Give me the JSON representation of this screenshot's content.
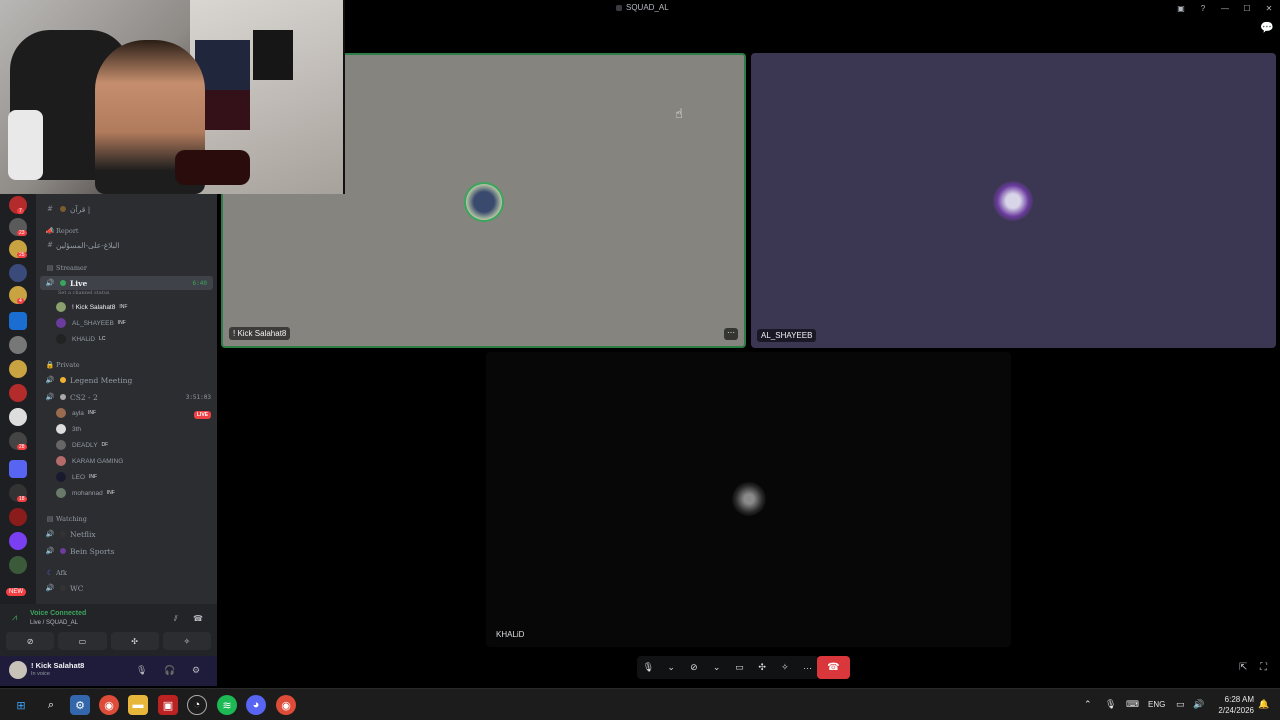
{
  "window": {
    "title": "SQUAD_AL"
  },
  "sidebar": {
    "quran_channel": "قرآن |",
    "cat_report": "Report",
    "report_channel": "البلاغ-على-المسؤلين",
    "cat_streamer": "Streamer",
    "live_channel": "Live",
    "live_time": "6:40",
    "live_status": "Set a channel status",
    "live_users": [
      {
        "name": "! Kick Salahat8",
        "tag": "INF"
      },
      {
        "name": "AL_SHAYEEB",
        "tag": "INF"
      },
      {
        "name": "KHALiD",
        "tag": "LC"
      }
    ],
    "cat_private": "Private",
    "legend_channel": "Legend Meeting",
    "cs2_channel": "CS2 - 2",
    "cs2_time": "3:51:03",
    "cs2_users": [
      {
        "name": "ayla",
        "tag": "INF"
      },
      {
        "name": "3th",
        "tag": ""
      },
      {
        "name": "DEADLY",
        "tag": "DF"
      },
      {
        "name": "KARAM GAMING",
        "tag": ""
      },
      {
        "name": "LEO",
        "tag": "INF"
      },
      {
        "name": "mohannad",
        "tag": "INF"
      }
    ],
    "live_badge": "LIVE",
    "cat_watching": "Watching",
    "netflix_channel": "Netflix",
    "bein_channel": "Bein Sports",
    "cat_afk": "Afk",
    "wc_channel": "WC"
  },
  "rail": {
    "new_badge": "NEW",
    "badges": [
      "7",
      "23",
      "25",
      "4",
      "28",
      "18",
      "30",
      "12"
    ]
  },
  "voice": {
    "title": "Voice Connected",
    "subtitle": "Live / SQUAD_AL"
  },
  "user": {
    "name": "! Kick Salahat8",
    "status": "In voice"
  },
  "tiles": [
    {
      "name": "! Kick Salahat8"
    },
    {
      "name": "AL_SHAYEEB"
    },
    {
      "name": "KHALiD"
    }
  ],
  "taskbar": {
    "lang": "ENG",
    "time": "6:28 AM",
    "date": "2/24/2026"
  },
  "colors": {
    "speaking": "#2d7d46",
    "hangup": "#da373c",
    "voice_green": "#3ba55d"
  }
}
